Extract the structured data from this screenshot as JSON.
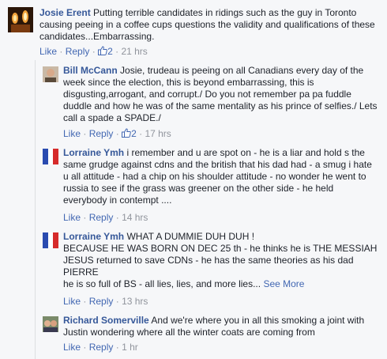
{
  "comments": [
    {
      "name": "Josie Erent",
      "text": "Putting terrible candidates in ridings such as the guy in Toronto causing peeing in a coffee cups questions the validity and qualifications of these candidates...Embarrassing.",
      "like_label": "Like",
      "reply_label": "Reply",
      "like_count": "2",
      "time": "21 hrs"
    },
    {
      "name": "Bill McCann",
      "text": "Josie, trudeau is peeing on all Canadians every day of the week since the election, this is beyond embarrassing, this is disgusting,arrogant, and corrupt./ Do you not remember pa pa fuddle duddle and how he was of the same mentality as his prince of selfies./ Lets call a spade a SPADE./",
      "like_label": "Like",
      "reply_label": "Reply",
      "like_count": "2",
      "time": "17 hrs"
    },
    {
      "name": "Lorraine Ymh",
      "text": "i remember and u are spot on - he is a liar and hold s the same grudge against cdns and the british that his dad had - a smug i hate u all attitude - had a chip on his shoulder attitude - no wonder he went to russia to see if the grass was greener on the other side - he held everybody in contempt ....",
      "like_label": "Like",
      "reply_label": "Reply",
      "time": "14 hrs"
    },
    {
      "name": "Lorraine Ymh",
      "text_lines": [
        "WHAT A DUMMIE DUH DUH !",
        "BECAUSE HE WAS BORN ON DEC 25 th - he thinks he is THE MESSIAH JESUS returned to save CDNs - he has the same theories as his dad PIERRE",
        "he is so full of BS - all lies, lies, and more lies..."
      ],
      "see_more": "See More",
      "like_label": "Like",
      "reply_label": "Reply",
      "time": "13 hrs"
    },
    {
      "name": "Richard Somerville",
      "text": "And we're where you in all this smoking a joint with Justin wondering where all the winter coats are coming from",
      "like_label": "Like",
      "reply_label": "Reply",
      "time": "1 hr"
    }
  ],
  "separator": "·",
  "colors": {
    "name": "#365899",
    "link": "#4267b2",
    "meta": "#90949c",
    "background": "#f6f7f9"
  }
}
